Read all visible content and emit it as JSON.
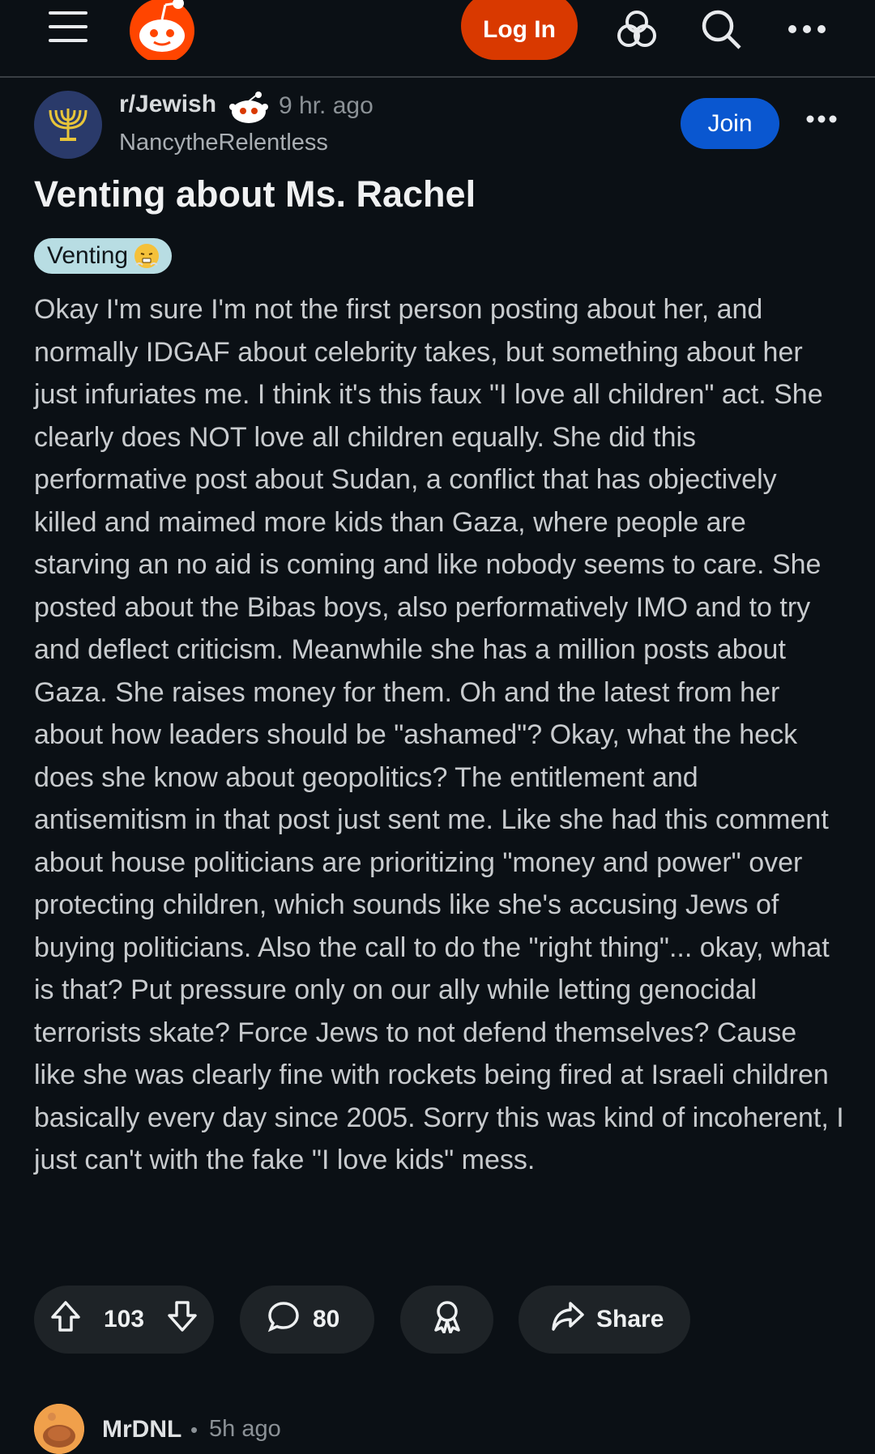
{
  "topbar": {
    "login_label": "Log In",
    "icons": [
      "menu-icon",
      "reddit-logo",
      "chat-icon",
      "search-icon",
      "more-icon"
    ]
  },
  "post": {
    "subreddit": "r/Jewish",
    "time": "9 hr. ago",
    "author": "NancytheRelentless",
    "join_label": "Join",
    "title": "Venting about Ms. Rachel",
    "flair": "Venting",
    "body": "Okay I'm sure I'm not the first person posting about her, and normally IDGAF about celebrity takes, but something about her just infuriates me. I think it's this faux \"I love all children\" act. She clearly does NOT love all children equally. She did this performative post about Sudan, a conflict that has objectively killed and maimed more kids than Gaza, where people are starving an no aid is coming and like nobody seems to care. She posted about the Bibas boys, also performatively IMO and to try and deflect criticism. Meanwhile she has a million posts about Gaza. She raises money for them. Oh and the latest from her about how leaders should be \"ashamed\"? Okay, what the heck does she know about geopolitics? The entitlement and antisemitism in that post just sent me. Like she had this comment about house politicians are prioritizing \"money and power\" over protecting children, which sounds like she's accusing Jews of buying politicians. Also the call to do the \"right thing\"... okay, what is that? Put pressure only on our ally while letting genocidal terrorists skate? Force Jews to not defend themselves? Cause like she was clearly fine with rockets being fired at Israeli children basically every day since 2005. Sorry this was kind of incoherent, I just can't with the fake \"I love kids\" mess."
  },
  "actions": {
    "score": "103",
    "comments": "80",
    "share_label": "Share"
  },
  "comment_preview": {
    "user": "MrDNL",
    "dot": "•",
    "time": "5h ago"
  },
  "colors": {
    "background": "#0b1015",
    "login": "#d93900",
    "join": "#0a57d0",
    "flair": "#b8dde3"
  }
}
